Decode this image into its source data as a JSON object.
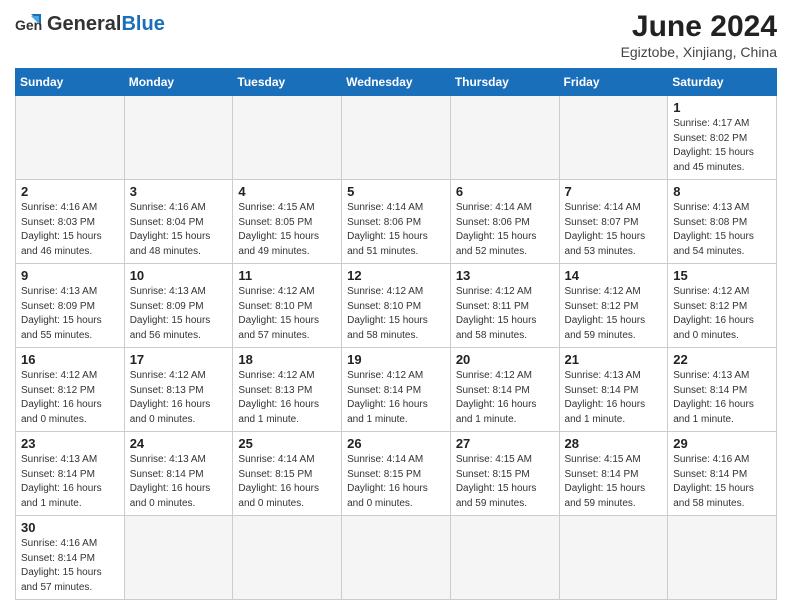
{
  "header": {
    "logo_general": "General",
    "logo_blue": "Blue",
    "month_title": "June 2024",
    "subtitle": "Egiztobe, Xinjiang, China"
  },
  "weekdays": [
    "Sunday",
    "Monday",
    "Tuesday",
    "Wednesday",
    "Thursday",
    "Friday",
    "Saturday"
  ],
  "weeks": [
    [
      {
        "day": "",
        "info": ""
      },
      {
        "day": "",
        "info": ""
      },
      {
        "day": "",
        "info": ""
      },
      {
        "day": "",
        "info": ""
      },
      {
        "day": "",
        "info": ""
      },
      {
        "day": "",
        "info": ""
      },
      {
        "day": "1",
        "info": "Sunrise: 4:17 AM\nSunset: 8:02 PM\nDaylight: 15 hours\nand 45 minutes."
      }
    ],
    [
      {
        "day": "2",
        "info": "Sunrise: 4:16 AM\nSunset: 8:03 PM\nDaylight: 15 hours\nand 46 minutes."
      },
      {
        "day": "3",
        "info": "Sunrise: 4:16 AM\nSunset: 8:04 PM\nDaylight: 15 hours\nand 48 minutes."
      },
      {
        "day": "4",
        "info": "Sunrise: 4:15 AM\nSunset: 8:05 PM\nDaylight: 15 hours\nand 49 minutes."
      },
      {
        "day": "5",
        "info": "Sunrise: 4:14 AM\nSunset: 8:06 PM\nDaylight: 15 hours\nand 51 minutes."
      },
      {
        "day": "6",
        "info": "Sunrise: 4:14 AM\nSunset: 8:06 PM\nDaylight: 15 hours\nand 52 minutes."
      },
      {
        "day": "7",
        "info": "Sunrise: 4:14 AM\nSunset: 8:07 PM\nDaylight: 15 hours\nand 53 minutes."
      },
      {
        "day": "8",
        "info": "Sunrise: 4:13 AM\nSunset: 8:08 PM\nDaylight: 15 hours\nand 54 minutes."
      }
    ],
    [
      {
        "day": "9",
        "info": "Sunrise: 4:13 AM\nSunset: 8:09 PM\nDaylight: 15 hours\nand 55 minutes."
      },
      {
        "day": "10",
        "info": "Sunrise: 4:13 AM\nSunset: 8:09 PM\nDaylight: 15 hours\nand 56 minutes."
      },
      {
        "day": "11",
        "info": "Sunrise: 4:12 AM\nSunset: 8:10 PM\nDaylight: 15 hours\nand 57 minutes."
      },
      {
        "day": "12",
        "info": "Sunrise: 4:12 AM\nSunset: 8:10 PM\nDaylight: 15 hours\nand 58 minutes."
      },
      {
        "day": "13",
        "info": "Sunrise: 4:12 AM\nSunset: 8:11 PM\nDaylight: 15 hours\nand 58 minutes."
      },
      {
        "day": "14",
        "info": "Sunrise: 4:12 AM\nSunset: 8:12 PM\nDaylight: 15 hours\nand 59 minutes."
      },
      {
        "day": "15",
        "info": "Sunrise: 4:12 AM\nSunset: 8:12 PM\nDaylight: 16 hours\nand 0 minutes."
      }
    ],
    [
      {
        "day": "16",
        "info": "Sunrise: 4:12 AM\nSunset: 8:12 PM\nDaylight: 16 hours\nand 0 minutes."
      },
      {
        "day": "17",
        "info": "Sunrise: 4:12 AM\nSunset: 8:13 PM\nDaylight: 16 hours\nand 0 minutes."
      },
      {
        "day": "18",
        "info": "Sunrise: 4:12 AM\nSunset: 8:13 PM\nDaylight: 16 hours\nand 1 minute."
      },
      {
        "day": "19",
        "info": "Sunrise: 4:12 AM\nSunset: 8:14 PM\nDaylight: 16 hours\nand 1 minute."
      },
      {
        "day": "20",
        "info": "Sunrise: 4:12 AM\nSunset: 8:14 PM\nDaylight: 16 hours\nand 1 minute."
      },
      {
        "day": "21",
        "info": "Sunrise: 4:13 AM\nSunset: 8:14 PM\nDaylight: 16 hours\nand 1 minute."
      },
      {
        "day": "22",
        "info": "Sunrise: 4:13 AM\nSunset: 8:14 PM\nDaylight: 16 hours\nand 1 minute."
      }
    ],
    [
      {
        "day": "23",
        "info": "Sunrise: 4:13 AM\nSunset: 8:14 PM\nDaylight: 16 hours\nand 1 minute."
      },
      {
        "day": "24",
        "info": "Sunrise: 4:13 AM\nSunset: 8:14 PM\nDaylight: 16 hours\nand 0 minutes."
      },
      {
        "day": "25",
        "info": "Sunrise: 4:14 AM\nSunset: 8:15 PM\nDaylight: 16 hours\nand 0 minutes."
      },
      {
        "day": "26",
        "info": "Sunrise: 4:14 AM\nSunset: 8:15 PM\nDaylight: 16 hours\nand 0 minutes."
      },
      {
        "day": "27",
        "info": "Sunrise: 4:15 AM\nSunset: 8:15 PM\nDaylight: 15 hours\nand 59 minutes."
      },
      {
        "day": "28",
        "info": "Sunrise: 4:15 AM\nSunset: 8:14 PM\nDaylight: 15 hours\nand 59 minutes."
      },
      {
        "day": "29",
        "info": "Sunrise: 4:16 AM\nSunset: 8:14 PM\nDaylight: 15 hours\nand 58 minutes."
      }
    ],
    [
      {
        "day": "30",
        "info": "Sunrise: 4:16 AM\nSunset: 8:14 PM\nDaylight: 15 hours\nand 57 minutes."
      },
      {
        "day": "",
        "info": ""
      },
      {
        "day": "",
        "info": ""
      },
      {
        "day": "",
        "info": ""
      },
      {
        "day": "",
        "info": ""
      },
      {
        "day": "",
        "info": ""
      },
      {
        "day": "",
        "info": ""
      }
    ]
  ]
}
